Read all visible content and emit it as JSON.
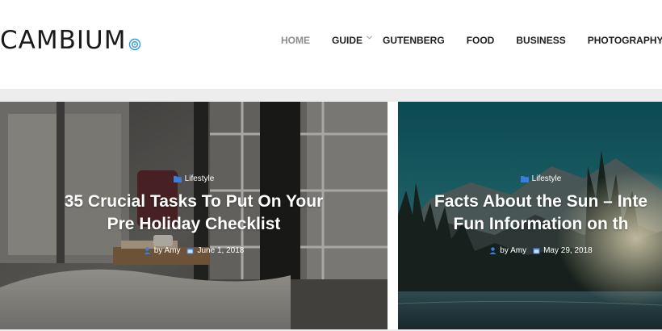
{
  "header": {
    "logo": "CAMBIUM",
    "nav": [
      {
        "label": "HOME",
        "active": true
      },
      {
        "label": "GUIDE",
        "has_dropdown": true
      },
      {
        "label": "GUTENBERG"
      },
      {
        "label": "FOOD"
      },
      {
        "label": "BUSINESS"
      },
      {
        "label": "PHOTOGRAPHY"
      }
    ]
  },
  "posts": [
    {
      "category": "Lifestyle",
      "title_line1": "35 Crucial Tasks To Put On Your",
      "title_line2": "Pre Holiday Checklist",
      "author": "by Amy",
      "date": "June 1, 2018"
    },
    {
      "category": "Lifestyle",
      "title_line1": "Facts About the Sun – Inte",
      "title_line2": "Fun Information on th",
      "author": "by Amy",
      "date": "May 29, 2018"
    }
  ],
  "colors": {
    "nav_active": "#8c8c8c",
    "nav_text": "#1e1e1e",
    "logo_accent": "#2b9bd6",
    "meta_icon": "#3b7ddd"
  }
}
